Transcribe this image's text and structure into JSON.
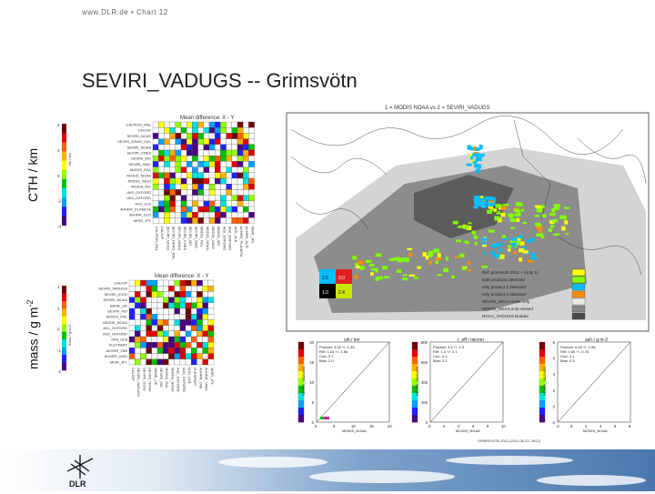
{
  "header": {
    "url": "www.DLR.de",
    "separator": "•",
    "chart": "Chart 12"
  },
  "slide": {
    "title": "SEVIRI_VADUGS -- Grimsvötn"
  },
  "axes_labels": {
    "cth": "CTH / km",
    "mass": "mass / g m",
    "mass_exp": "-2"
  },
  "matrix_top": {
    "title": "Mean difference: X - Y",
    "row_labels": [
      "CALIPSO_RAL",
      "CALIOP",
      "SEVIRI_NCAS",
      "SEVIRI_DRAO_RAL",
      "SEVIRI_NOAA",
      "SEVIRI_CNES",
      "SEVIRI_MO",
      "SEVIRI_ISAC",
      "MODIS_RAL",
      "MODIS_NOAA",
      "MODIS_INDO",
      "MODIS_MO",
      "IASI_DXFORD",
      "IASI_DXFORD",
      "IASI_ULB",
      "AVHRR_PLANETA",
      "AVHRR_DLR",
      "MISR_JPL"
    ],
    "colorbar_ticks": [
      "4",
      "2",
      "0",
      "-2",
      "-4"
    ],
    "colorbar_label": "ctc / km"
  },
  "matrix_bottom": {
    "title": "Mean difference: X - Y",
    "row_labels": [
      "CALIOP",
      "SEVIRI_VADUGS",
      "SEVIRI_ICOG",
      "SEVIRI_NOAA",
      "NAME_UK",
      "SEVIRI_MO",
      "MODIS_RAL",
      "MODIS_NOAA",
      "ASL_DXFORD",
      "IASI_OXFORD",
      "IASI_ULB",
      "FLEXPART",
      "AVHRR_OMI",
      "AVHRR_UMO",
      "MISR_JPL"
    ],
    "colorbar_ticks": [
      "2",
      "1",
      "0",
      "-1",
      "-2"
    ],
    "colorbar_label": "mass / g m-2"
  },
  "map": {
    "title": "1 = MODIS NOAA vs 2 = SEVIRI_VADUGS",
    "legend_box": [
      "2.5",
      "3.0",
      "1.0",
      "2.4"
    ],
    "legend_text": [
      "Ref: grimsvotn 2011 + (only 1)",
      "both products detected",
      "only product 1 detected",
      "only product 2 detected",
      "SEVIRI_NOAA mask only",
      "MODIS_NOAA only missed",
      "NOAA_VADUGS Nodata"
    ],
    "legend_swatches": [
      "#ffff00",
      "#7fff00",
      "#00bfff",
      "#ff8c00",
      "#e8e8e8",
      "#888888",
      "#4a4a4a"
    ]
  },
  "scatter_plots": [
    {
      "title": "cth / km",
      "lines": [
        "Product: 3.09 +/- 1.33",
        "Ref: 1.23 +/- 1.86",
        "Corr: 0.7",
        "Bias: 2.0"
      ],
      "xlabel": "MODIS_NOAA",
      "ylabel": "SEVIRI_VADUGS",
      "xticks": [
        "0",
        "5",
        "10",
        "15",
        "20"
      ],
      "yticks": [
        "0",
        "5",
        "10",
        "15",
        "20"
      ]
    },
    {
      "title": "r_eff / micron",
      "lines": [
        "Product: 3.5 +/- 1.9",
        "Ref: 1.3 +/- 1.1",
        "Corr: 0.4",
        "Bias: 2.2"
      ],
      "xlabel": "MODIS_NOAA",
      "ylabel": "SEVIRI_VADUGS",
      "xticks": [
        "0",
        "2",
        "4",
        "6",
        "8",
        "10"
      ],
      "yticks": [
        "0",
        "200",
        "400",
        "600",
        "800"
      ]
    },
    {
      "title": "ash / g m-2",
      "lines": [
        "Product: 0.93 +/- 1.56",
        "Ref: 0.60 +/- 0.78",
        "Corr: 0.1",
        "Bias: 0.3"
      ],
      "xlabel": "MODIS_NOAA",
      "ylabel": "SEVIRI_VADUGS",
      "xticks": [
        "-2",
        "0",
        "2",
        "4",
        "6",
        "8"
      ],
      "yticks": [
        "-2",
        "0",
        "2",
        "4",
        "6",
        "8"
      ]
    }
  ],
  "scatter_footer": "GRIMSVOTN 2011 (2011-05-22, 2022)",
  "colors": {
    "title": "#222222",
    "footer_sky": "#5a86b8"
  }
}
